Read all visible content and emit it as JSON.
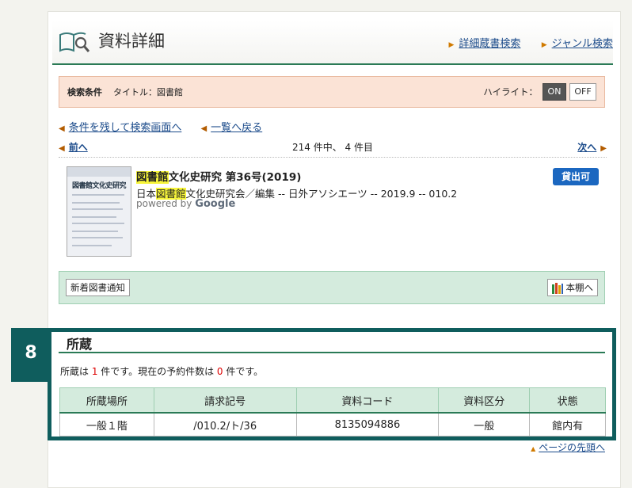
{
  "header": {
    "title": "資料詳細",
    "link_detail_search": "詳細蔵書検索",
    "link_genre_search": "ジャンル検索"
  },
  "condition": {
    "label": "検索条件",
    "value": "タイトル：図書館",
    "highlight_label": "ハイライト：",
    "on": "ON",
    "off": "OFF"
  },
  "nav": {
    "back_search": "条件を残して検索画面へ",
    "back_list": "一覧へ戻る"
  },
  "pager": {
    "prev": "前へ",
    "count": "214 件中、 4 件目",
    "next": "次へ"
  },
  "record": {
    "title_hl": "図書館",
    "title_rest": "文化史研究 第36号(2019)",
    "meta_pre": "日本",
    "meta_hl": "図書館",
    "meta_rest": "文化史研究会／編集 -- 日外アソシエーツ -- 2019.9 -- 010.2",
    "powered_by": "powered by",
    "google": "Google",
    "status": "貸出可",
    "cover_title": "図書館文化史研究"
  },
  "actions": {
    "new_books": "新着図書通知",
    "shelf": "本棚へ"
  },
  "holdings": {
    "step_badge": "8",
    "heading": "所蔵",
    "text_pre": "所蔵は ",
    "count": "1",
    "text_mid": " 件です。現在の予約件数は ",
    "reserve_count": "0",
    "text_post": " 件です。",
    "columns": [
      "所蔵場所",
      "請求記号",
      "資料コード",
      "資料区分",
      "状態"
    ],
    "rows": [
      [
        "一般１階",
        "/010.2/ト/36",
        "8135094886",
        "一般",
        "館内有"
      ]
    ]
  },
  "footer": {
    "page_top": "ページの先頭へ"
  },
  "colors": {
    "accent_green": "#2a7a56",
    "badge_teal": "#0f5d5d",
    "available_blue": "#1b67c0",
    "highlight_yellow": "#f7f53a"
  }
}
